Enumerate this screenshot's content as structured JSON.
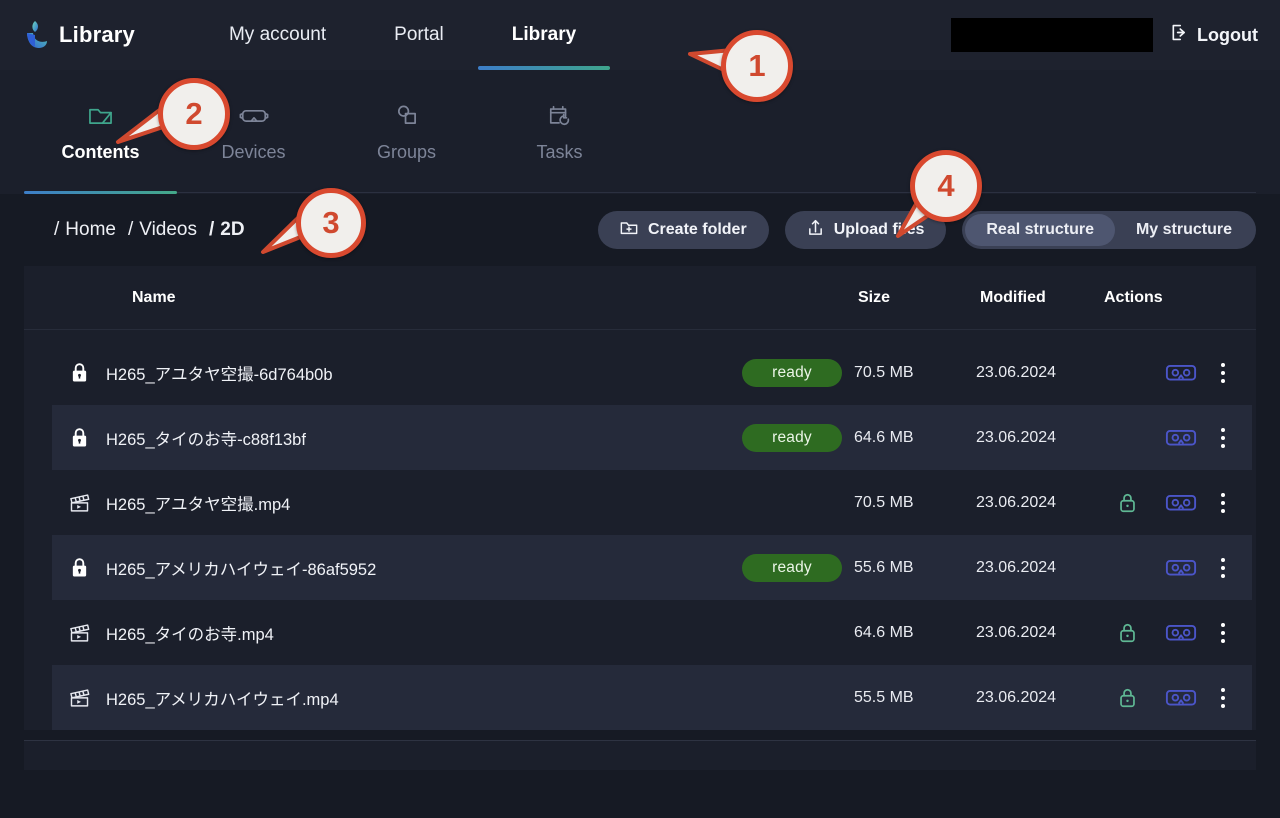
{
  "brand": {
    "title": "Library",
    "logo_icon": "library-logo-icon"
  },
  "topnav": {
    "items": [
      {
        "label": "My account",
        "active": false
      },
      {
        "label": "Portal",
        "active": false
      },
      {
        "label": "Library",
        "active": true
      }
    ],
    "account_field_value": "",
    "account_field_placeholder": "",
    "logout_label": "Logout",
    "logout_icon": "logout-icon",
    "active_underline_color": "#3d7ec9"
  },
  "subnav": {
    "items": [
      {
        "label": "Contents",
        "icon": "folder-icon",
        "active": true
      },
      {
        "label": "Devices",
        "icon": "vr-headset-icon",
        "active": false
      },
      {
        "label": "Groups",
        "icon": "groups-icon",
        "active": false
      },
      {
        "label": "Tasks",
        "icon": "calendar-refresh-icon",
        "active": false
      }
    ]
  },
  "breadcrumb": {
    "segments": [
      {
        "sep": "/",
        "label": "Home",
        "current": false
      },
      {
        "sep": "/",
        "label": "Videos",
        "current": false
      },
      {
        "sep": "/",
        "label": "2D",
        "current": true
      }
    ]
  },
  "toolbar": {
    "create_folder_label": "Create folder",
    "create_folder_icon": "folder-plus-icon",
    "upload_files_label": "Upload files",
    "upload_files_icon": "upload-icon",
    "structure_toggle": {
      "options": [
        {
          "label": "Real structure",
          "active": true
        },
        {
          "label": "My structure",
          "active": false
        }
      ]
    }
  },
  "table": {
    "headers": {
      "name": "Name",
      "size": "Size",
      "modified": "Modified",
      "actions": "Actions"
    },
    "rows": [
      {
        "icon": "lock-icon",
        "name": "H265_アユタヤ空撮-6d764b0b",
        "status": "ready",
        "size": "70.5 MB",
        "modified": "23.06.2024",
        "has_lock_action": false,
        "vr_action_icon": "vr-goggles-icon",
        "menu_icon": "kebab-menu-icon",
        "alt": false
      },
      {
        "icon": "lock-icon",
        "name": "H265_タイのお寺-c88f13bf",
        "status": "ready",
        "size": "64.6 MB",
        "modified": "23.06.2024",
        "has_lock_action": false,
        "vr_action_icon": "vr-goggles-icon",
        "menu_icon": "kebab-menu-icon",
        "alt": true
      },
      {
        "icon": "video-file-icon",
        "name": "H265_アユタヤ空撮.mp4",
        "status": "",
        "size": "70.5 MB",
        "modified": "23.06.2024",
        "has_lock_action": true,
        "vr_action_icon": "vr-goggles-icon",
        "menu_icon": "kebab-menu-icon",
        "alt": false
      },
      {
        "icon": "lock-icon",
        "name": "H265_アメリカハイウェイ-86af5952",
        "status": "ready",
        "size": "55.6 MB",
        "modified": "23.06.2024",
        "has_lock_action": false,
        "vr_action_icon": "vr-goggles-icon",
        "menu_icon": "kebab-menu-icon",
        "alt": true
      },
      {
        "icon": "video-file-icon",
        "name": "H265_タイのお寺.mp4",
        "status": "",
        "size": "64.6 MB",
        "modified": "23.06.2024",
        "has_lock_action": true,
        "vr_action_icon": "vr-goggles-icon",
        "menu_icon": "kebab-menu-icon",
        "alt": false
      },
      {
        "icon": "video-file-icon",
        "name": "H265_アメリカハイウェイ.mp4",
        "status": "",
        "size": "55.5 MB",
        "modified": "23.06.2024",
        "has_lock_action": true,
        "vr_action_icon": "vr-goggles-icon",
        "menu_icon": "kebab-menu-icon",
        "alt": true
      }
    ]
  },
  "callouts": [
    {
      "number": "1"
    },
    {
      "number": "2"
    },
    {
      "number": "3"
    },
    {
      "number": "4"
    }
  ],
  "colors": {
    "page_bg": "#161a24",
    "panel_bg": "#1b1f2b",
    "topbar_bg": "#1e222e",
    "row_alt_bg": "#252a3a",
    "badge_green": "#2e6b21",
    "accent_blue": "#3d7ec9",
    "accent_green": "#44a989",
    "vr_icon_blue": "#4b55c9",
    "lock_green": "#5fb894",
    "callout_red": "#d0492f",
    "callout_fill": "#f1efec",
    "button_bg": "#3a4054",
    "segment_active_bg": "#4e5670"
  }
}
